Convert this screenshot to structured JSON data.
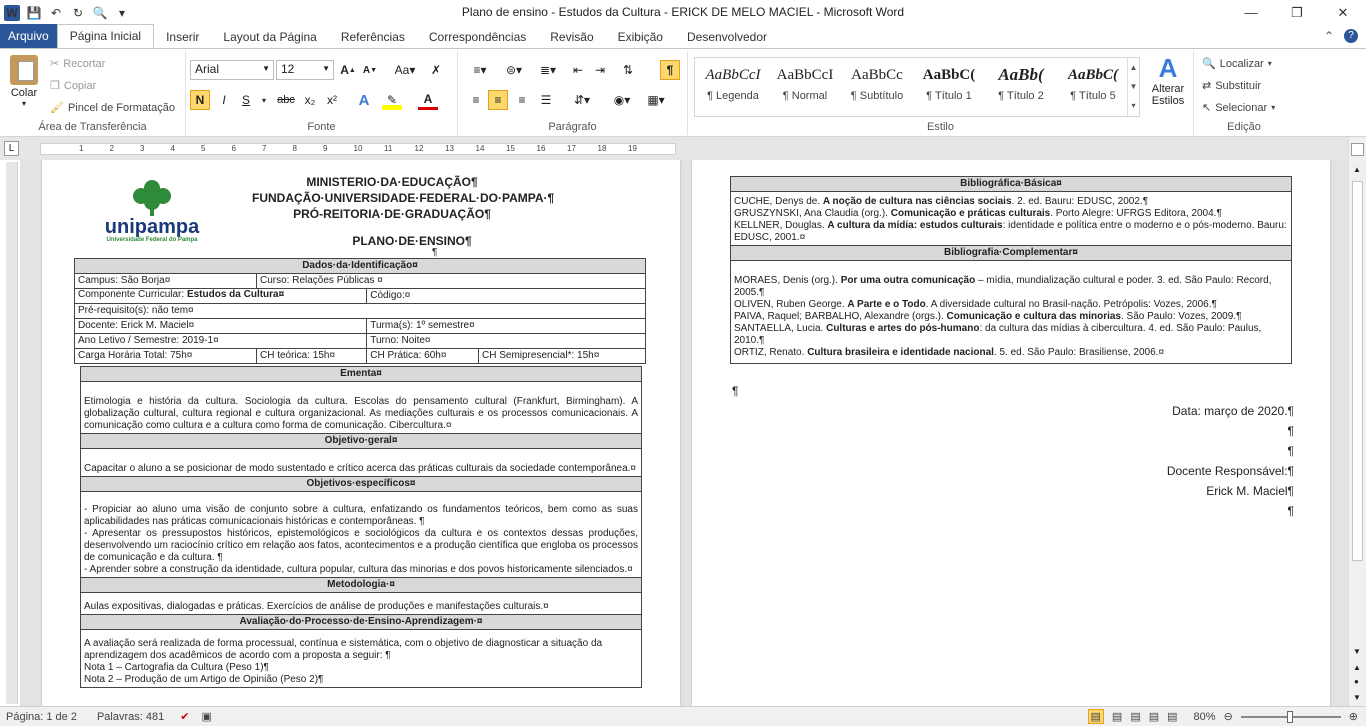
{
  "window": {
    "title": "Plano de ensino - Estudos da Cultura - ERICK DE MELO MACIEL  -  Microsoft Word"
  },
  "tabs": [
    "Arquivo",
    "Página Inicial",
    "Inserir",
    "Layout da Página",
    "Referências",
    "Correspondências",
    "Revisão",
    "Exibição",
    "Desenvolvedor"
  ],
  "ribbon": {
    "clipboard": {
      "paste": "Colar",
      "cut": "Recortar",
      "copy": "Copiar",
      "format_painter": "Pincel de Formatação",
      "label": "Área de Transferência"
    },
    "font": {
      "name": "Arial",
      "size": "12",
      "label": "Fonte",
      "bold": "N",
      "italic": "I",
      "underline": "S",
      "strike": "abc",
      "sub": "x₂",
      "sup": "x²"
    },
    "paragraph": {
      "label": "Parágrafo",
      "pilcrow": "¶"
    },
    "styles": {
      "label": "Estilo",
      "items": [
        {
          "preview": "AaBbCcI",
          "name": "¶ Legenda"
        },
        {
          "preview": "AaBbCcI",
          "name": "¶ Normal"
        },
        {
          "preview": "AaBbCc",
          "name": "¶ Subtítulo"
        },
        {
          "preview": "AaBbC(",
          "name": "¶ Título 1"
        },
        {
          "preview": "AaBb(",
          "name": "¶ Título 2"
        },
        {
          "preview": "AaBbC(",
          "name": "¶ Título 5"
        }
      ],
      "change": "Alterar Estilos"
    },
    "editing": {
      "label": "Edição",
      "find": "Localizar",
      "replace": "Substituir",
      "select": "Selecionar"
    }
  },
  "ruler_numbers": [
    "1",
    "2",
    "3",
    "4",
    "5",
    "6",
    "7",
    "8",
    "9",
    "10",
    "11",
    "12",
    "13",
    "14",
    "15",
    "16",
    "17",
    "18",
    "19"
  ],
  "page1": {
    "org": [
      "MINISTERIO·DA·EDUCAÇÃO¶",
      "FUNDAÇÃO·UNIVERSIDADE·FEDERAL·DO·PAMPA·¶",
      "PRÓ-REITORIA·DE·GRADUAÇÃO¶"
    ],
    "logo_name": "unipampa",
    "logo_sub": "Universidade Federal do Pampa",
    "plan_title": "PLANO·DE·ENSINO¶",
    "id_header": "Dados·da·Identificação¤",
    "campus": "Campus: São Borja¤",
    "curso": "Curso: Relações Públicas ¤",
    "componente_pre": "Componente Curricular: ",
    "componente_bold": "Estudos da Cultura¤",
    "codigo": "Código:¤",
    "prereq": "Pré-requisito(s): não tem¤",
    "docente": "Docente: Erick M. Maciel¤",
    "turma": "Turma(s): 1º semestre¤",
    "ano": "Ano Letivo / Semestre: 2019-1¤",
    "turno": "Turno: Noite¤",
    "ch_total": "Carga Horária Total: 75h¤",
    "ch_teorica": "CH teórica: 15h¤",
    "ch_pratica": "CH Prática: 60h¤",
    "ch_semi": "CH Semipresencial*: 15h¤",
    "ementa_h": "Ementa¤",
    "ementa": "Etimologia e história da cultura. Sociologia da cultura. Escolas do pensamento cultural (Frankfurt, Birmingham). A globalização cultural, cultura regional e cultura organizacional. As mediações culturais e os processos comunicacionais. A comunicação como cultura e a cultura como forma de comunicação. Cibercultura.¤",
    "objgeral_h": "Objetivo·geral¤",
    "objgeral": "Capacitar o aluno a se posicionar de modo sustentado e crítico acerca das práticas culturais da sociedade contemporânea.¤",
    "objesp_h": "Objetivos·específicos¤",
    "objesp": [
      "- Propiciar ao aluno uma visão de conjunto sobre a cultura, enfatizando os fundamentos teóricos, bem como as suas aplicabilidades nas práticas comunicacionais históricas e contemporâneas. ¶",
      "- Apresentar os pressupostos históricos, epistemológicos e sociológicos da cultura e os contextos dessas produções, desenvolvendo um raciocínio crítico em relação aos fatos, acontecimentos e a produção científica que engloba os processos de comunicação e da cultura. ¶",
      "- Aprender sobre a construção da identidade, cultura popular, cultura das minorias e dos povos historicamente silenciados.¤"
    ],
    "metod_h": "Metodologia·¤",
    "metod": "Aulas expositivas, dialogadas e práticas. Exercícios de análise de produções e manifestações culturais.¤",
    "aval_h": "Avaliação·do·Processo·de·Ensino-Aprendizagem·¤",
    "aval": [
      "A avaliação será realizada de forma processual, contínua e sistemática, com o objetivo de diagnosticar a situação da aprendizagem dos acadêmicos de acordo com a proposta a seguir: ¶",
      "Nota 1 – Cartografia da Cultura (Peso 1)¶",
      "Nota 2 – Produção de um Artigo de Opinião (Peso 2)¶"
    ]
  },
  "page2": {
    "basic_h": "Bibliográfica·Básica¤",
    "basic": [
      {
        "pre": "CUCHE, Denys de. ",
        "b": "A noção de cultura nas ciências sociais",
        "post": ". 2. ed. Bauru: EDUSC, 2002.¶"
      },
      {
        "pre": "GRUSZYNSKI, Ana Claudia (org.). ",
        "b": "Comunicação e práticas culturais",
        "post": ". Porto Alegre: UFRGS Editora, 2004.¶"
      },
      {
        "pre": "KELLNER, Douglas. ",
        "b": "A cultura da mídia: estudos culturais",
        "post": ": identidade e política entre o moderno e o pós-moderno. Bauru: EDUSC, 2001.¤"
      }
    ],
    "comp_h": "Bibliografia·Complementar¤",
    "comp": [
      {
        "pre": "MORAES, Denis (org.). ",
        "b": "Por uma outra comunicação",
        "post": " – mídia, mundialização cultural e poder. 3. ed. São Paulo: Record, 2005.¶"
      },
      {
        "pre": "OLIVEN, Ruben George. ",
        "b": "A Parte e o Todo",
        "post": ". A diversidade cultural no Brasil-nação. Petrópolis: Vozes, 2006.¶"
      },
      {
        "pre": "PAIVA, Raquel; BARBALHO, Alexandre (orgs.). ",
        "b": "Comunicação e cultura das minorias",
        "post": ". São Paulo: Vozes, 2009.¶"
      },
      {
        "pre": "SANTAELLA, Lucia. ",
        "b": "Culturas e artes do pós-humano",
        "post": ": da cultura das mídias à cibercultura. 4. ed. São Paulo: Paulus, 2010.¶"
      },
      {
        "pre": "ORTIZ, Renato. ",
        "b": "Cultura brasileira e identidade nacional",
        "post": ". 5. ed. São Paulo: Brasiliense, 2006.¤"
      }
    ],
    "date": "Data: março de 2020.¶",
    "role": "Docente Responsável:¶",
    "name": "Erick M. Maciel¶",
    "pil": "¶"
  },
  "status": {
    "page": "Página: 1 de 2",
    "words": "Palavras: 481",
    "zoom": "80%"
  }
}
